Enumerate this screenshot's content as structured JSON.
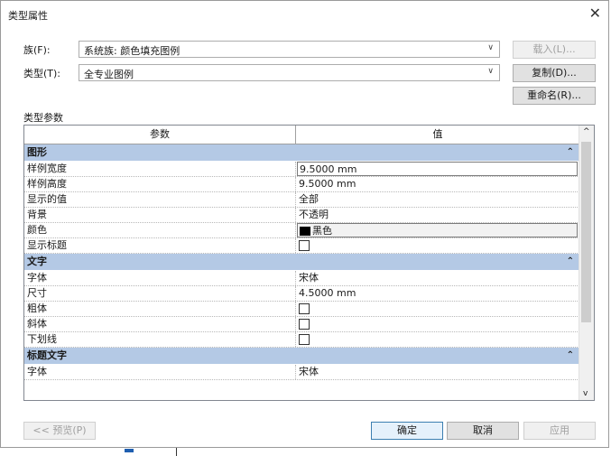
{
  "window": {
    "title": "类型属性"
  },
  "family": {
    "label": "族(F):",
    "value": "系统族: 颜色填充图例",
    "load_button": "载入(L)..."
  },
  "type": {
    "label": "类型(T):",
    "value": "全专业图例",
    "duplicate_button": "复制(D)...",
    "rename_button": "重命名(R)..."
  },
  "section_label": "类型参数",
  "grid": {
    "col_param": "参数",
    "col_value": "值",
    "groups": [
      {
        "name": "图形",
        "rows": [
          {
            "k": "样例宽度",
            "v": "9.5000 mm"
          },
          {
            "k": "样例高度",
            "v": "9.5000 mm"
          },
          {
            "k": "显示的值",
            "v": "全部"
          },
          {
            "k": "背景",
            "v": "不透明"
          },
          {
            "k": "颜色",
            "v": "黑色"
          },
          {
            "k": "显示标题",
            "v": ""
          }
        ]
      },
      {
        "name": "文字",
        "rows": [
          {
            "k": "字体",
            "v": "宋体"
          },
          {
            "k": "尺寸",
            "v": "4.5000 mm"
          },
          {
            "k": "粗体",
            "v": ""
          },
          {
            "k": "斜体",
            "v": ""
          },
          {
            "k": "下划线",
            "v": ""
          }
        ]
      },
      {
        "name": "标题文字",
        "rows": [
          {
            "k": "字体",
            "v": "宋体"
          }
        ]
      }
    ]
  },
  "footer": {
    "preview_button": "<< 预览(P)",
    "ok_button": "确定",
    "cancel_button": "取消",
    "apply_button": "应用"
  }
}
